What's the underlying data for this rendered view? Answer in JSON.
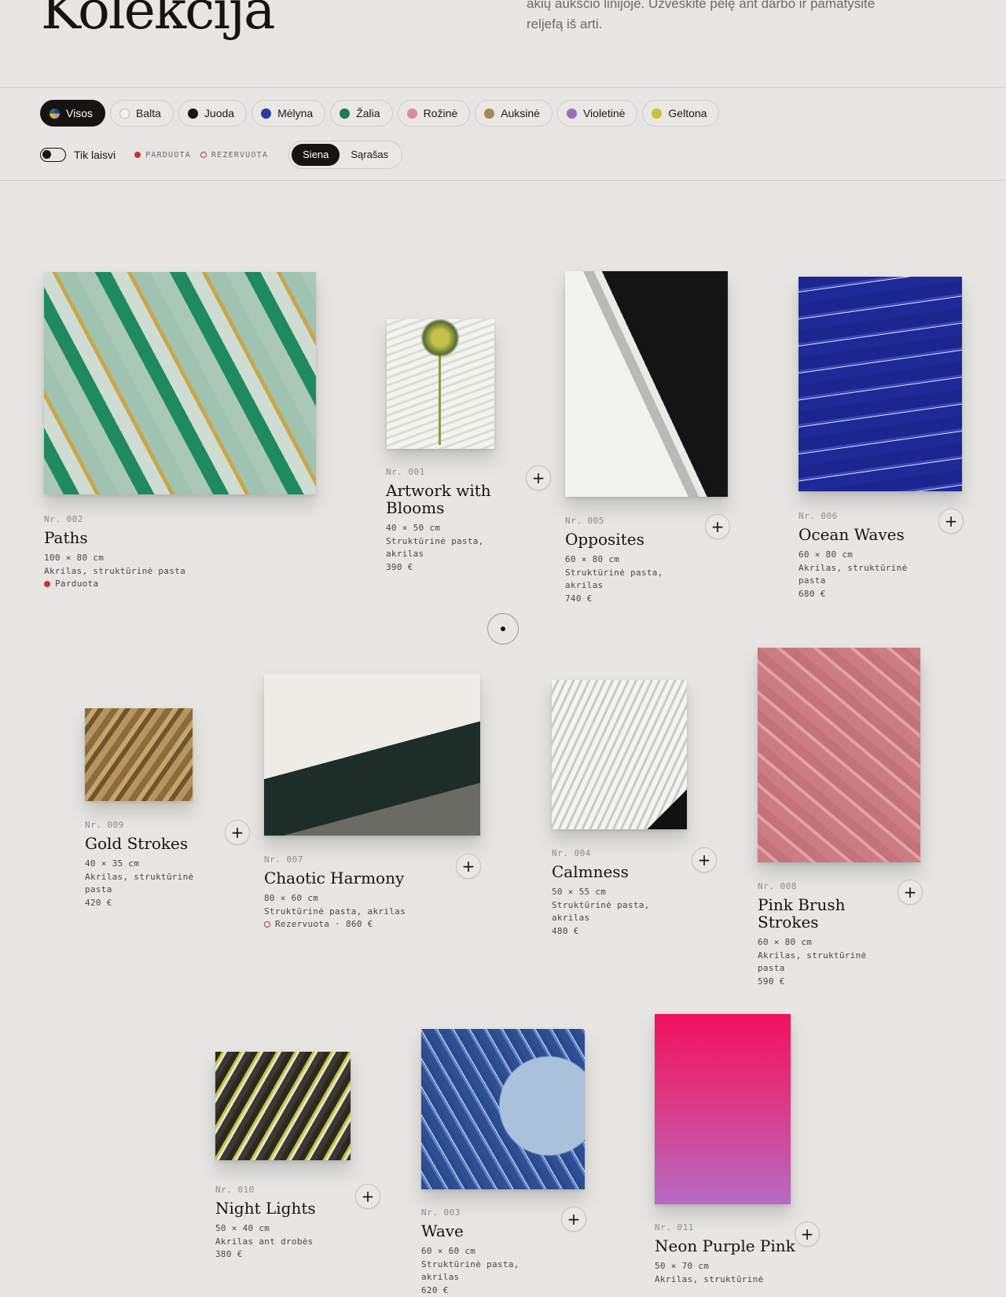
{
  "header": {
    "title": "Kolekcija",
    "intro": "akių aukščio linijoje. Užveskite pelę ant darbo ir pamatysite reljefą iš arti."
  },
  "filters": {
    "colors": [
      {
        "label": "Visos",
        "color": "#f2f2f2",
        "active": true
      },
      {
        "label": "Balta",
        "color": "#f4f3ef"
      },
      {
        "label": "Juoda",
        "color": "#151412"
      },
      {
        "label": "Mėlyna",
        "color": "#2b3aa0"
      },
      {
        "label": "Žalia",
        "color": "#1f7a57"
      },
      {
        "label": "Rožinė",
        "color": "#d98ba0"
      },
      {
        "label": "Auksinė",
        "color": "#a8875a"
      },
      {
        "label": "Violetinė",
        "color": "#9a6fb8"
      },
      {
        "label": "Geltona",
        "color": "#c8c23a"
      }
    ],
    "available_only_label": "Tik laisvi",
    "legend_sold": "PARDUOTA",
    "legend_reserved": "REZERVUOTA",
    "view_wall": "Siena",
    "view_list": "Sąrašas"
  },
  "accent": {
    "sold": "#c8332e",
    "reserved": "#c8332e"
  },
  "artworks": [
    {
      "nr": "Nr. 002",
      "title": "Paths",
      "size": "100 × 80 cm",
      "material": "Akrilas, struktūrinė pasta",
      "status": "Parduota"
    },
    {
      "nr": "Nr. 001",
      "title": "Artwork with Blooms",
      "size": "40 × 50 cm",
      "material": "Struktūrinė pasta, akrilas",
      "price": "390 €"
    },
    {
      "nr": "Nr. 005",
      "title": "Opposites",
      "size": "60 × 80 cm",
      "material": "Struktūrinė pasta, akrilas",
      "price": "740 €"
    },
    {
      "nr": "Nr. 006",
      "title": "Ocean Waves",
      "size": "60 × 80 cm",
      "material": "Akrilas, struktūrinė pasta",
      "price": "680 €"
    },
    {
      "nr": "Nr. 009",
      "title": "Gold Strokes",
      "size": "40 × 35 cm",
      "material": "Akrilas, struktūrinė pasta",
      "price": "420 €"
    },
    {
      "nr": "Nr. 007",
      "title": "Chaotic Harmony",
      "size": "80 × 60 cm",
      "material": "Struktūrinė pasta, akrilas",
      "status": "Rezervuota · 860 €"
    },
    {
      "nr": "Nr. 004",
      "title": "Calmness",
      "size": "50 × 55 cm",
      "material": "Struktūrinė pasta, akrilas",
      "price": "480 €"
    },
    {
      "nr": "Nr. 008",
      "title": "Pink Brush Strokes",
      "size": "60 × 80 cm",
      "material": "Akrilas, struktūrinė pasta",
      "price": "590 €"
    },
    {
      "nr": "Nr. 010",
      "title": "Night Lights",
      "size": "50 × 40 cm",
      "material": "Akrilas ant drobės",
      "price": "380 €"
    },
    {
      "nr": "Nr. 003",
      "title": "Wave",
      "size": "60 × 60 cm",
      "material": "Struktūrinė pasta, akrilas",
      "price": "620 €"
    },
    {
      "nr": "Nr. 011",
      "title": "Neon Purple Pink",
      "size": "50 × 70 cm",
      "material": "Akrilas, struktūrinė"
    }
  ],
  "icons": {
    "add": "plus-icon",
    "scroll": "dot-icon"
  }
}
